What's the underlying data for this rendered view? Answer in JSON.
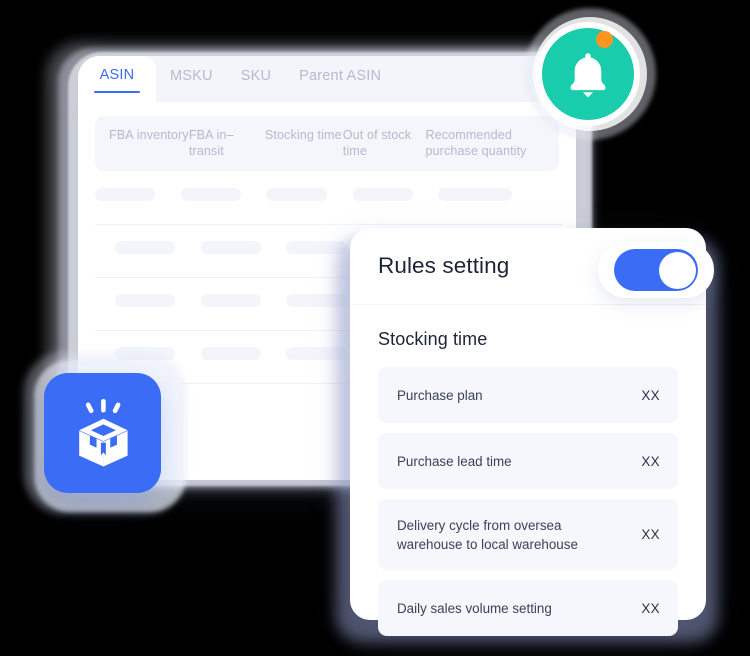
{
  "window": {
    "tabs": [
      {
        "label": "ASIN",
        "active": true
      },
      {
        "label": "MSKU",
        "active": false
      },
      {
        "label": "SKU",
        "active": false
      },
      {
        "label": "Parent ASIN",
        "active": false
      }
    ],
    "table": {
      "columns": [
        "FBA inventory",
        "FBA in–transit",
        "Stocking time",
        "Out of stock time",
        "Recommended purchase quantity"
      ],
      "placeholder_row_count": 4
    }
  },
  "badges": {
    "notification": {
      "icon": "bell-icon",
      "color": "#19ccab",
      "dot_color": "#ff9420"
    },
    "product": {
      "icon": "open-box-icon",
      "color": "#3b6cf6"
    }
  },
  "rules_panel": {
    "title": "Rules setting",
    "toggle": {
      "on": true,
      "color": "#3b6cf6"
    },
    "section_title": "Stocking time",
    "rules": [
      {
        "label": "Purchase plan",
        "value": "XX"
      },
      {
        "label": "Purchase lead time",
        "value": "XX"
      },
      {
        "label": "Delivery cycle from oversea warehouse to local warehouse",
        "value": "XX"
      },
      {
        "label": "Daily sales volume setting",
        "value": "XX"
      }
    ]
  },
  "colors": {
    "accent_blue": "#3b6cf6",
    "accent_teal": "#19ccab",
    "accent_orange": "#ff9420",
    "text_dark": "#1e2438",
    "text_muted": "#b3bacd",
    "surface_light": "#f5f7fc"
  }
}
